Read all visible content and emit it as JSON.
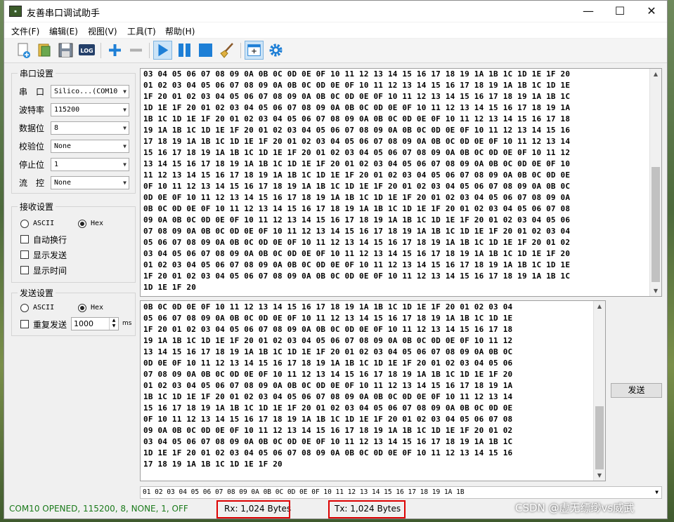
{
  "window": {
    "title": "友善串口调试助手",
    "app_icon": "app-icon",
    "minimize": "—",
    "maximize": "☐",
    "close": "✕"
  },
  "menu": [
    "文件(F)",
    "编辑(E)",
    "视图(V)",
    "工具(T)",
    "帮助(H)"
  ],
  "toolbar": {
    "log_label": "LOG",
    "icons": [
      "new-icon",
      "open-icon",
      "save-icon",
      "log-icon",
      "add-icon",
      "remove-icon",
      "play-icon",
      "pause-icon",
      "stop-icon",
      "clear-icon",
      "new-window-icon",
      "settings-icon"
    ],
    "accent": "#1e7fd6"
  },
  "serial": {
    "title": "串口设置",
    "rows": [
      {
        "label": "串　口",
        "value": "Silico...(COM10"
      },
      {
        "label": "波特率",
        "value": "115200"
      },
      {
        "label": "数据位",
        "value": "8"
      },
      {
        "label": "校验位",
        "value": "None"
      },
      {
        "label": "停止位",
        "value": "1"
      },
      {
        "label": "流　控",
        "value": "None"
      }
    ]
  },
  "receive": {
    "title": "接收设置",
    "ascii": "ASCII",
    "hex": "Hex",
    "selected": "Hex",
    "options": [
      "自动换行",
      "显示发送",
      "显示时间"
    ]
  },
  "send": {
    "title": "发送设置",
    "ascii": "ASCII",
    "hex": "Hex",
    "selected": "Hex",
    "repeat_label": "重复发送",
    "interval": "1000",
    "unit": "ms",
    "button": "发送"
  },
  "rx_text": "03 04 05 06 07 08 09 0A 0B 0C 0D 0E 0F 10 11 12 13 14 15 16 17 18 19 1A 1B 1C 1D 1E 1F 20\n01 02 03 04 05 06 07 08 09 0A 0B 0C 0D 0E 0F 10 11 12 13 14 15 16 17 18 19 1A 1B 1C 1D 1E\n1F 20 01 02 03 04 05 06 07 08 09 0A 0B 0C 0D 0E 0F 10 11 12 13 14 15 16 17 18 19 1A 1B 1C\n1D 1E 1F 20 01 02 03 04 05 06 07 08 09 0A 0B 0C 0D 0E 0F 10 11 12 13 14 15 16 17 18 19 1A\n1B 1C 1D 1E 1F 20 01 02 03 04 05 06 07 08 09 0A 0B 0C 0D 0E 0F 10 11 12 13 14 15 16 17 18\n19 1A 1B 1C 1D 1E 1F 20 01 02 03 04 05 06 07 08 09 0A 0B 0C 0D 0E 0F 10 11 12 13 14 15 16\n17 18 19 1A 1B 1C 1D 1E 1F 20 01 02 03 04 05 06 07 08 09 0A 0B 0C 0D 0E 0F 10 11 12 13 14\n15 16 17 18 19 1A 1B 1C 1D 1E 1F 20 01 02 03 04 05 06 07 08 09 0A 0B 0C 0D 0E 0F 10 11 12\n13 14 15 16 17 18 19 1A 1B 1C 1D 1E 1F 20 01 02 03 04 05 06 07 08 09 0A 0B 0C 0D 0E 0F 10\n11 12 13 14 15 16 17 18 19 1A 1B 1C 1D 1E 1F 20 01 02 03 04 05 06 07 08 09 0A 0B 0C 0D 0E\n0F 10 11 12 13 14 15 16 17 18 19 1A 1B 1C 1D 1E 1F 20 01 02 03 04 05 06 07 08 09 0A 0B 0C\n0D 0E 0F 10 11 12 13 14 15 16 17 18 19 1A 1B 1C 1D 1E 1F 20 01 02 03 04 05 06 07 08 09 0A\n0B 0C 0D 0E 0F 10 11 12 13 14 15 16 17 18 19 1A 1B 1C 1D 1E 1F 20 01 02 03 04 05 06 07 08\n09 0A 0B 0C 0D 0E 0F 10 11 12 13 14 15 16 17 18 19 1A 1B 1C 1D 1E 1F 20 01 02 03 04 05 06\n07 08 09 0A 0B 0C 0D 0E 0F 10 11 12 13 14 15 16 17 18 19 1A 1B 1C 1D 1E 1F 20 01 02 03 04\n05 06 07 08 09 0A 0B 0C 0D 0E 0F 10 11 12 13 14 15 16 17 18 19 1A 1B 1C 1D 1E 1F 20 01 02\n03 04 05 06 07 08 09 0A 0B 0C 0D 0E 0F 10 11 12 13 14 15 16 17 18 19 1A 1B 1C 1D 1E 1F 20\n01 02 03 04 05 06 07 08 09 0A 0B 0C 0D 0E 0F 10 11 12 13 14 15 16 17 18 19 1A 1B 1C 1D 1E\n1F 20 01 02 03 04 05 06 07 08 09 0A 0B 0C 0D 0E 0F 10 11 12 13 14 15 16 17 18 19 1A 1B 1C\n1D 1E 1F 20",
  "tx_text": "0B 0C 0D 0E 0F 10 11 12 13 14 15 16 17 18 19 1A 1B 1C 1D 1E 1F 20 01 02 03 04\n05 06 07 08 09 0A 0B 0C 0D 0E 0F 10 11 12 13 14 15 16 17 18 19 1A 1B 1C 1D 1E\n1F 20 01 02 03 04 05 06 07 08 09 0A 0B 0C 0D 0E 0F 10 11 12 13 14 15 16 17 18\n19 1A 1B 1C 1D 1E 1F 20 01 02 03 04 05 06 07 08 09 0A 0B 0C 0D 0E 0F 10 11 12\n13 14 15 16 17 18 19 1A 1B 1C 1D 1E 1F 20 01 02 03 04 05 06 07 08 09 0A 0B 0C\n0D 0E 0F 10 11 12 13 14 15 16 17 18 19 1A 1B 1C 1D 1E 1F 20 01 02 03 04 05 06\n07 08 09 0A 0B 0C 0D 0E 0F 10 11 12 13 14 15 16 17 18 19 1A 1B 1C 1D 1E 1F 20\n01 02 03 04 05 06 07 08 09 0A 0B 0C 0D 0E 0F 10 11 12 13 14 15 16 17 18 19 1A\n1B 1C 1D 1E 1F 20 01 02 03 04 05 06 07 08 09 0A 0B 0C 0D 0E 0F 10 11 12 13 14\n15 16 17 18 19 1A 1B 1C 1D 1E 1F 20 01 02 03 04 05 06 07 08 09 0A 0B 0C 0D 0E\n0F 10 11 12 13 14 15 16 17 18 19 1A 1B 1C 1D 1E 1F 20 01 02 03 04 05 06 07 08\n09 0A 0B 0C 0D 0E 0F 10 11 12 13 14 15 16 17 18 19 1A 1B 1C 1D 1E 1F 20 01 02\n03 04 05 06 07 08 09 0A 0B 0C 0D 0E 0F 10 11 12 13 14 15 16 17 18 19 1A 1B 1C\n1D 1E 1F 20 01 02 03 04 05 06 07 08 09 0A 0B 0C 0D 0E 0F 10 11 12 13 14 15 16\n17 18 19 1A 1B 1C 1D 1E 1F 20",
  "send_input": "01 02 03 04 05 06 07 08 09 0A 0B 0C 0D 0E 0F 10 11 12 13 14 15 16 17 18 19 1A 1B",
  "status": {
    "port": "COM10 OPENED, 115200, 8, NONE, 1, OFF",
    "rx": "Rx: 1,024 Bytes",
    "tx": "Tx: 1,024 Bytes",
    "port_color": "#1a7a1a",
    "highlight_color": "#d00000"
  },
  "watermark": "CSDN @虚无缥缈vs威武"
}
